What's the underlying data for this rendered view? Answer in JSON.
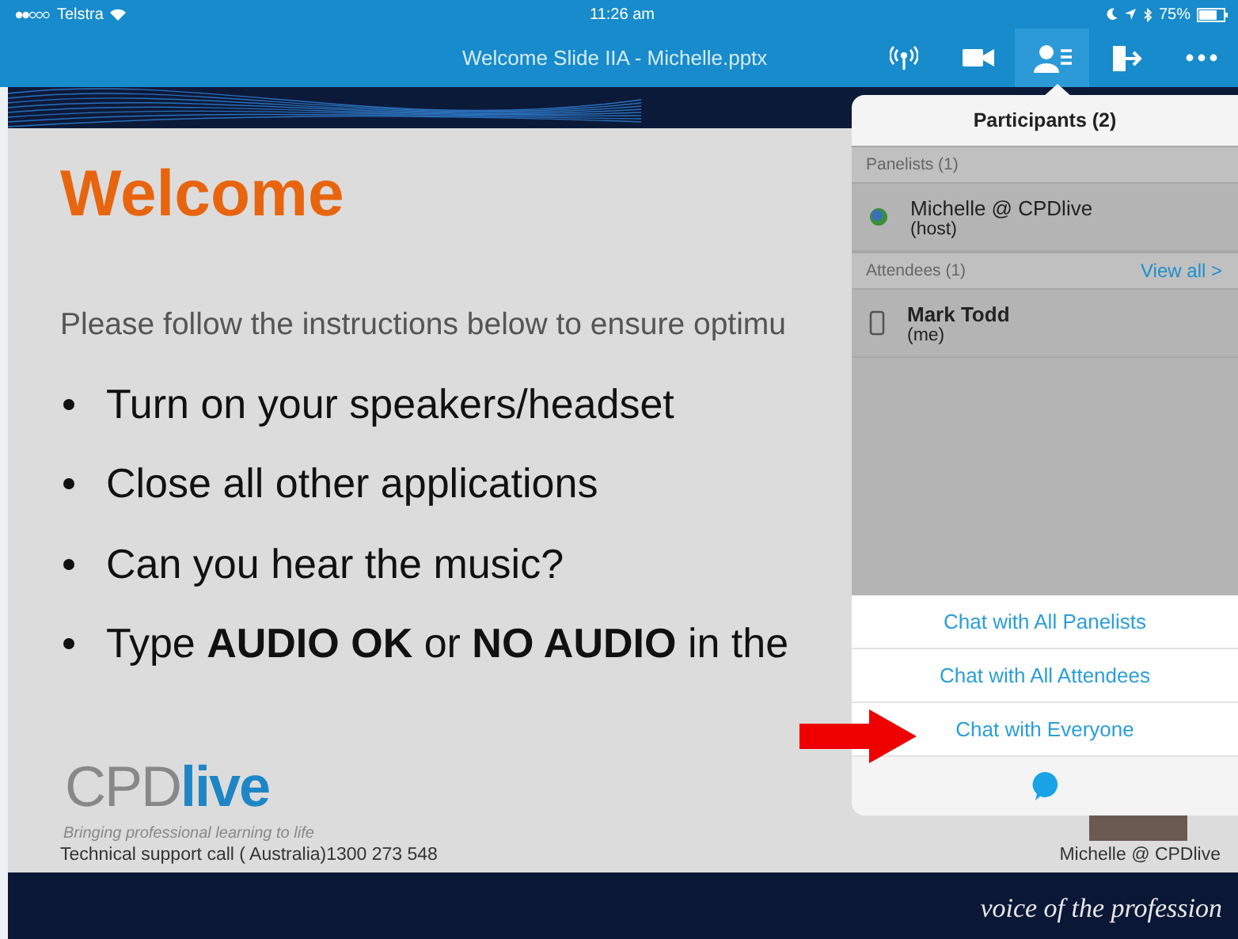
{
  "status_bar": {
    "carrier": "Telstra",
    "time": "11:26 am",
    "battery": "75%"
  },
  "toolbar": {
    "title": "Welcome Slide IIA - Michelle.pptx",
    "icons": [
      {
        "kind": "broadcast",
        "selected": false
      },
      {
        "kind": "video",
        "selected": false
      },
      {
        "kind": "participants",
        "selected": true
      },
      {
        "kind": "exit",
        "selected": false
      },
      {
        "kind": "more",
        "selected": false
      }
    ]
  },
  "slide": {
    "heading": "Welcome",
    "intro": "Please follow the instructions below to ensure optimu",
    "bullets": [
      "Turn on your speakers/headset",
      "Close all other applications",
      "Can you hear the music?",
      "Type **AUDIO OK** or **NO AUDIO** in the"
    ],
    "logo": {
      "part_1": "CPD",
      "part_2": "live"
    },
    "tagline": "Bringing professional learning to life",
    "support": "Technical support call ( Australia)1300 273 548",
    "presenter": "Michelle @ CPDlive",
    "footer": "voice of the profession"
  },
  "participants_popover": {
    "title": "Participants (2)",
    "sections": [
      {
        "label": "Panelists (1)",
        "participants": [
          {
            "name": "Michelle @ CPDlive",
            "role": "(host)",
            "kind": "host"
          }
        ]
      },
      {
        "label": "Attendees (1)",
        "action": "View all >",
        "participants": [
          {
            "name": "Mark Todd",
            "role": "(me)",
            "kind": "device"
          }
        ]
      }
    ],
    "chat_options": [
      "Chat with All Panelists",
      "Chat with All Attendees",
      "Chat with Everyone"
    ]
  }
}
